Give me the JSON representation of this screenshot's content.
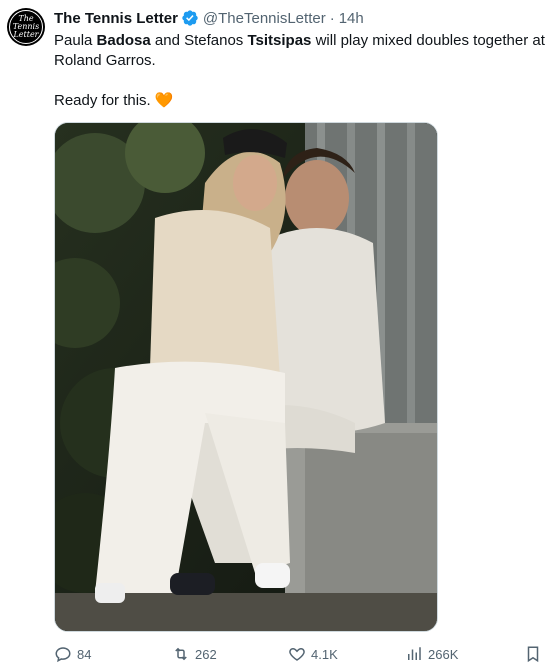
{
  "tweet": {
    "author_name": "The Tennis Letter",
    "handle": "@TheTennisLetter",
    "separator": "·",
    "time": "14h",
    "avatar_text": [
      "The",
      "Tennis",
      "Letter"
    ],
    "text": {
      "line1_a": "Paula ",
      "line1_b": "Badosa",
      "line1_c": " and Stefanos ",
      "line1_d": "Tsitsipas",
      "line1_e": " will play mixed doubles together at",
      "line2": "Roland Garros.",
      "line3": "Ready for this.",
      "emoji": "🧡"
    }
  },
  "actions": {
    "replies": "84",
    "retweets": "262",
    "likes": "4.1K",
    "views": "266K"
  },
  "icons": {
    "verified": "verified-badge-icon",
    "reply": "reply-icon",
    "retweet": "retweet-icon",
    "like": "heart-icon",
    "views": "views-icon",
    "bookmark": "bookmark-icon"
  },
  "colors": {
    "verified": "#1d9bf0",
    "text": "#0f1419",
    "secondary": "#536471",
    "heart_emoji": "#f5841f"
  }
}
